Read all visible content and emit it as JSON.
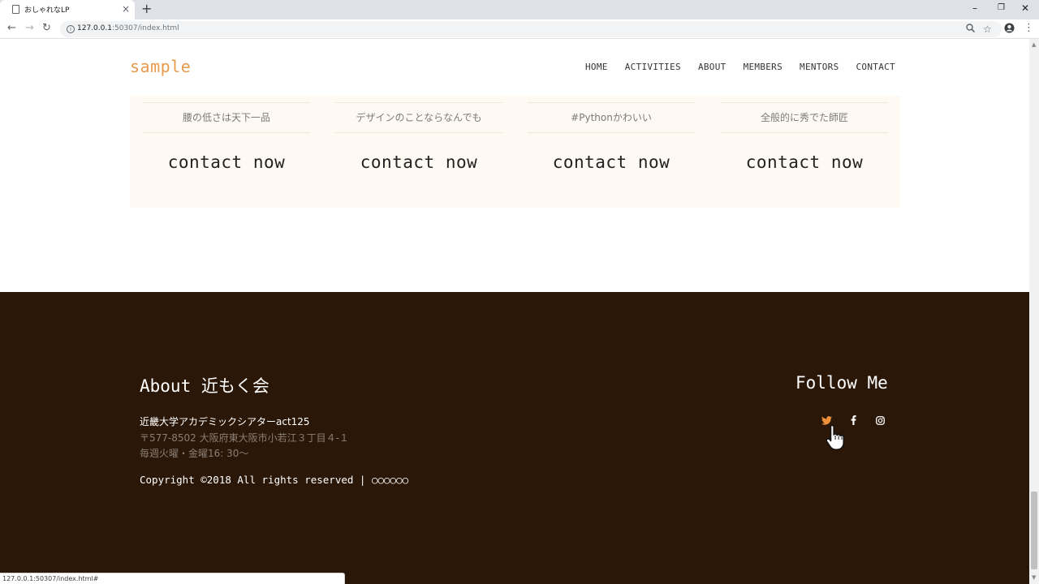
{
  "browser": {
    "tab_title": "おしゃれなLP",
    "tab_close": "×",
    "new_tab": "+",
    "url_host": "127.0.0.1",
    "url_path": ":50307/index.html",
    "status_url": "127.0.0.1:50307/index.html#",
    "minimize": "–",
    "restore": "❐",
    "close": "✕"
  },
  "header": {
    "logo": "sample",
    "nav": [
      "HOME",
      "ACTIVITIES",
      "ABOUT",
      "MEMBERS",
      "MENTORS",
      "CONTACT"
    ]
  },
  "cards": [
    {
      "desc": "腰の低さは天下一品",
      "cta": "contact now"
    },
    {
      "desc": "デザインのことならなんでも",
      "cta": "contact now"
    },
    {
      "desc": "#Pythonかわいい",
      "cta": "contact now"
    },
    {
      "desc": "全般的に秀でた師匠",
      "cta": "contact now"
    }
  ],
  "footer": {
    "about_title": "About 近もく会",
    "org_name": "近畿大学アカデミックシアターact125",
    "address": "〒577-8502 大阪府東大阪市小若江３丁目４-１",
    "schedule": "毎週火曜・金曜16: 30～",
    "copyright": "Copyright ©2018 All rights reserved | ○○○○○○",
    "follow_title": "Follow Me",
    "social_icons": [
      "twitter-icon",
      "facebook-icon",
      "instagram-icon"
    ]
  },
  "colors": {
    "accent": "#e89a4d",
    "footer_bg": "#2b1708",
    "card_bg": "#fefaf3",
    "twitter_active": "#f0913a"
  }
}
